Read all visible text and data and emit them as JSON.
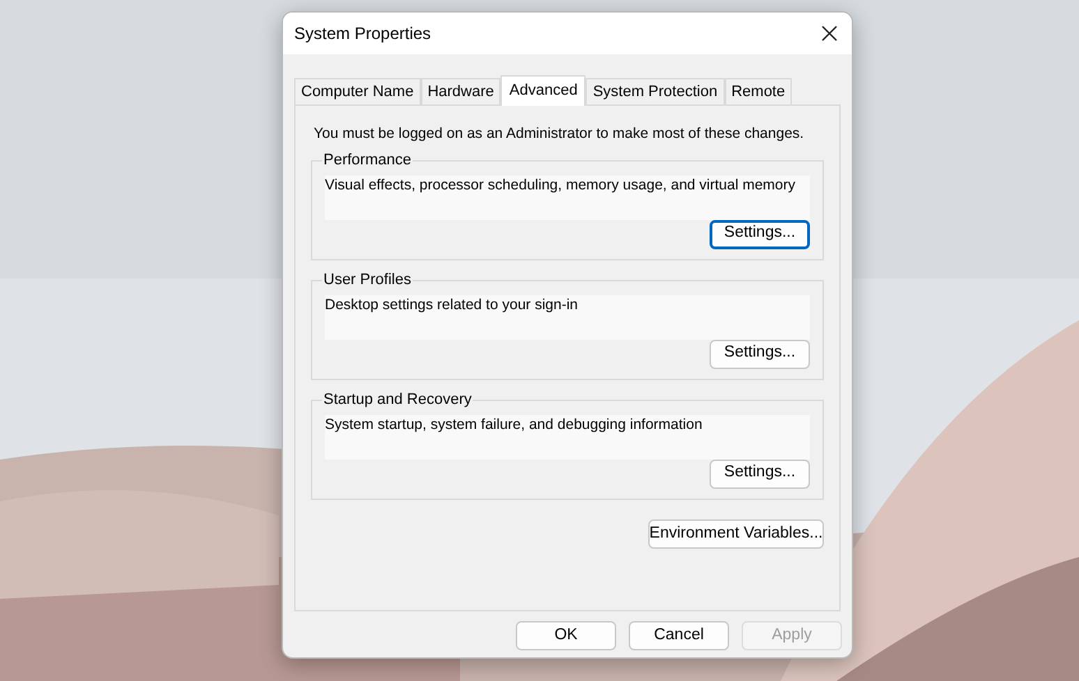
{
  "window": {
    "title": "System Properties"
  },
  "tabs": [
    {
      "label": "Computer Name",
      "selected": false
    },
    {
      "label": "Hardware",
      "selected": false
    },
    {
      "label": "Advanced",
      "selected": true
    },
    {
      "label": "System Protection",
      "selected": false
    },
    {
      "label": "Remote",
      "selected": false
    }
  ],
  "notice": "You must be logged on as an Administrator to make most of these changes.",
  "groups": [
    {
      "title": "Performance",
      "description": "Visual effects, processor scheduling, memory usage, and virtual memory",
      "button": {
        "label": "Settings...",
        "focused": true
      }
    },
    {
      "title": "User Profiles",
      "description": "Desktop settings related to your sign-in",
      "button": {
        "label": "Settings...",
        "focused": false
      }
    },
    {
      "title": "Startup and Recovery",
      "description": "System startup, system failure, and debugging information",
      "button": {
        "label": "Settings...",
        "focused": false
      }
    }
  ],
  "environment_button": {
    "label": "Environment Variables...",
    "focused": false
  },
  "footer_buttons": [
    {
      "label": "OK",
      "disabled": false
    },
    {
      "label": "Cancel",
      "disabled": false
    },
    {
      "label": "Apply",
      "disabled": true
    }
  ]
}
